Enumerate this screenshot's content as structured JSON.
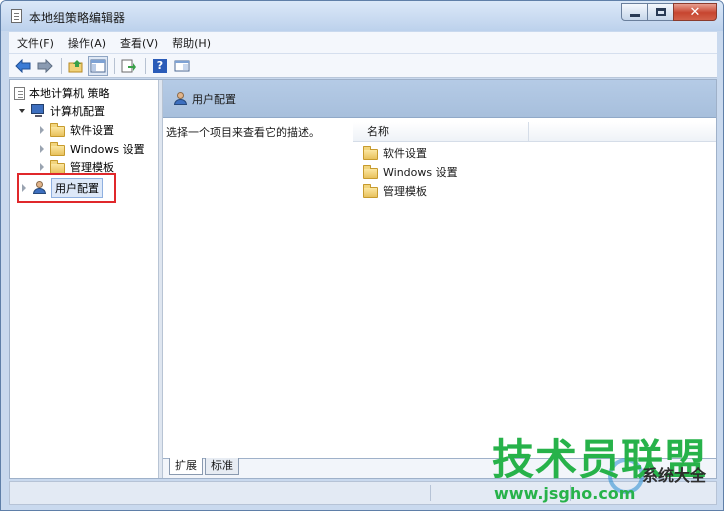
{
  "window": {
    "title": "本地组策略编辑器",
    "close_glyph": "✕"
  },
  "menu": [
    "文件(F)",
    "操作(A)",
    "查看(V)",
    "帮助(H)"
  ],
  "toolbar": {
    "help_glyph": "?"
  },
  "tree": {
    "root": "本地计算机 策略",
    "computer_config": "计算机配置",
    "software_settings": "软件设置",
    "windows_settings": "Windows 设置",
    "admin_templates": "管理模板",
    "user_config": "用户配置"
  },
  "right_pane": {
    "header_title": "用户配置",
    "description": "选择一个项目来查看它的描述。",
    "column_name": "名称",
    "items": [
      "软件设置",
      "Windows 设置",
      "管理模板"
    ]
  },
  "tabs": [
    "扩展",
    "标准"
  ],
  "watermark": {
    "main": "技术员联盟",
    "url": "www.jsgho.com",
    "sub": "系统大全"
  },
  "colors": {
    "highlight": "#e0282b",
    "watermark_green": "#27b24a",
    "header_blue": "#b5cbe6"
  }
}
